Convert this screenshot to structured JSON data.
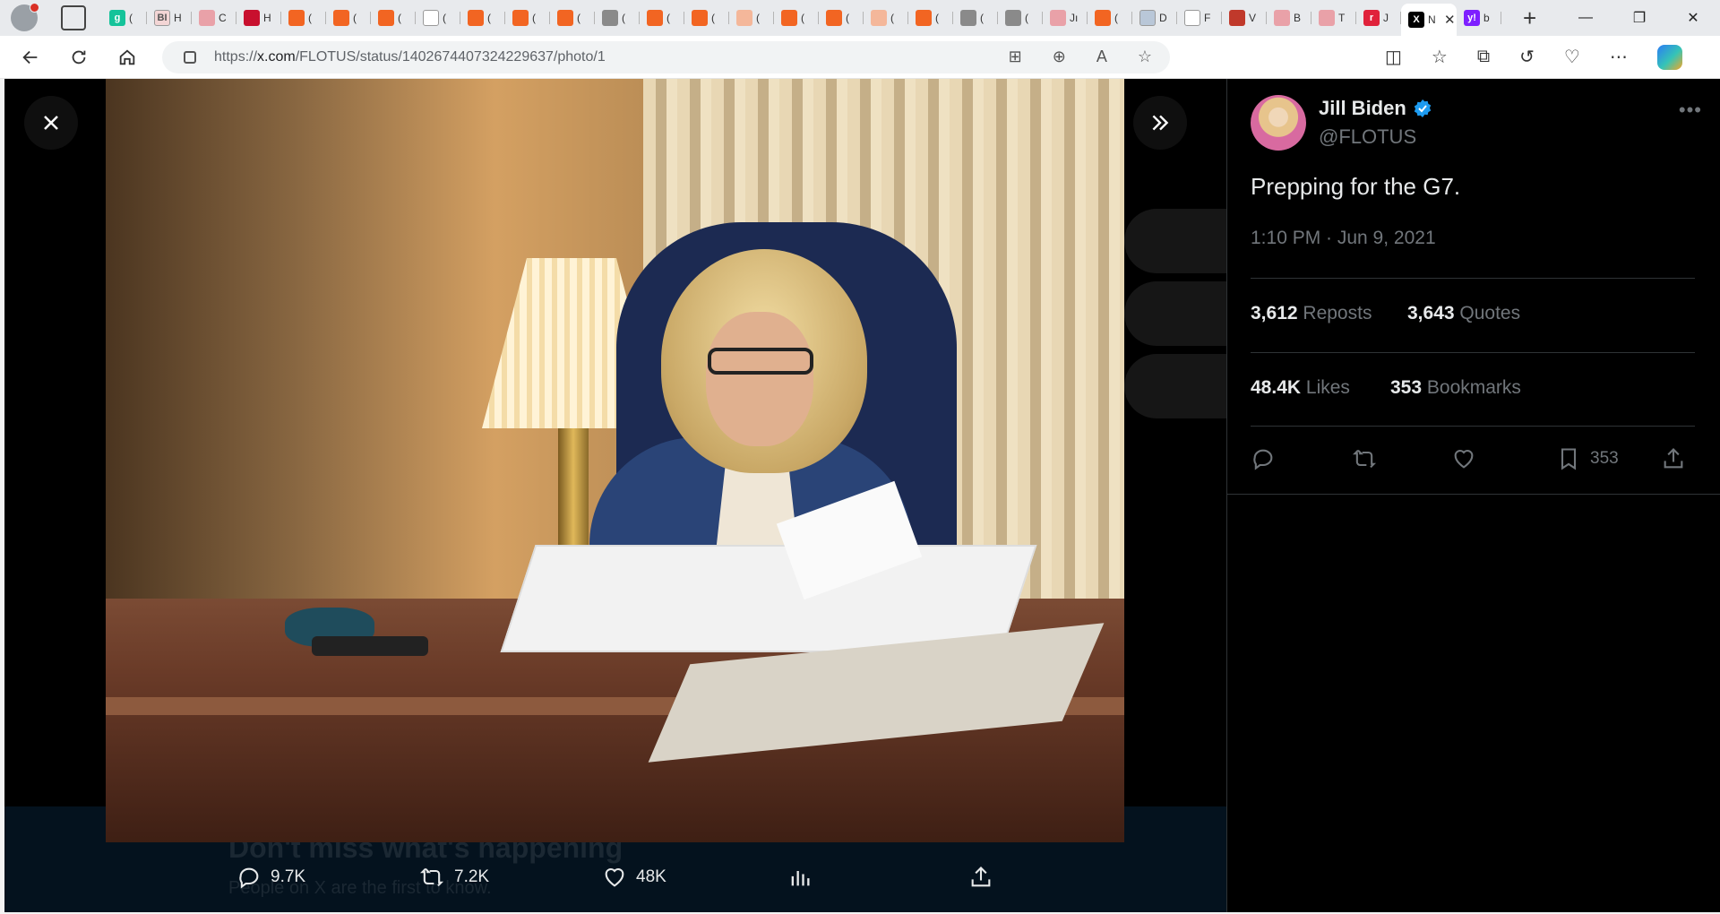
{
  "browser": {
    "tabs": [
      {
        "icon": "grammarly-icon",
        "letter": "g",
        "title": "(",
        "color": "#15c39a"
      },
      {
        "icon": "bi-icon",
        "letter": "BI",
        "title": "H",
        "color": "#f3d5d5"
      },
      {
        "icon": "youtube-icon",
        "letter": "",
        "title": "C",
        "color": "#e9a1a8"
      },
      {
        "icon": "news-icon",
        "letter": "",
        "title": "H",
        "color": "#c8102e"
      },
      {
        "icon": "bookmark-icon",
        "letter": "",
        "title": "(",
        "color": "#f26522"
      },
      {
        "icon": "bookmark-icon",
        "letter": "",
        "title": "(",
        "color": "#f26522"
      },
      {
        "icon": "bookmark-icon",
        "letter": "",
        "title": "(",
        "color": "#f26522"
      },
      {
        "icon": "document-icon",
        "letter": "",
        "title": "(",
        "color": "#ffffff"
      },
      {
        "icon": "bookmark-icon",
        "letter": "",
        "title": "(",
        "color": "#f26522"
      },
      {
        "icon": "bookmark-icon",
        "letter": "",
        "title": "(",
        "color": "#f26522"
      },
      {
        "icon": "bookmark-icon",
        "letter": "",
        "title": "(",
        "color": "#f26522"
      },
      {
        "icon": "photo-icon",
        "letter": "",
        "title": "(",
        "color": "#8a8a8a"
      },
      {
        "icon": "bookmark-icon",
        "letter": "",
        "title": "(",
        "color": "#f26522"
      },
      {
        "icon": "bookmark-icon",
        "letter": "",
        "title": "(",
        "color": "#f26522"
      },
      {
        "icon": "bookmark-icon",
        "letter": "",
        "title": "(",
        "color": "#f4b79a"
      },
      {
        "icon": "bookmark-icon",
        "letter": "",
        "title": "(",
        "color": "#f26522"
      },
      {
        "icon": "bookmark-icon",
        "letter": "",
        "title": "(",
        "color": "#f26522"
      },
      {
        "icon": "bookmark-icon",
        "letter": "",
        "title": "(",
        "color": "#f4b79a"
      },
      {
        "icon": "bookmark-icon",
        "letter": "",
        "title": "(",
        "color": "#f26522"
      },
      {
        "icon": "photo-icon",
        "letter": "",
        "title": "(",
        "color": "#8a8a8a"
      },
      {
        "icon": "photo-icon",
        "letter": "",
        "title": "(",
        "color": "#8a8a8a"
      },
      {
        "icon": "youtube-icon",
        "letter": "",
        "title": "Jı",
        "color": "#e9a1a8"
      },
      {
        "icon": "bookmark-icon",
        "letter": "",
        "title": "(",
        "color": "#f26522"
      },
      {
        "icon": "puzzle-icon",
        "letter": "",
        "title": "D",
        "color": "#b9c7d8"
      },
      {
        "icon": "document-icon",
        "letter": "",
        "title": "F",
        "color": "#ffffff"
      },
      {
        "icon": "star-icon",
        "letter": "",
        "title": "V",
        "color": "#c0392b"
      },
      {
        "icon": "youtube-icon",
        "letter": "",
        "title": "B",
        "color": "#e9a1a8"
      },
      {
        "icon": "youtube-icon",
        "letter": "",
        "title": "T",
        "color": "#e9a1a8"
      },
      {
        "icon": "r-icon",
        "letter": "r",
        "title": "J",
        "color": "#e0223b"
      }
    ],
    "active_tab": {
      "icon": "x-icon",
      "letter": "X",
      "title": "N",
      "close": "✕"
    },
    "after_tabs": [
      {
        "icon": "yahoo-icon",
        "letter": "y!",
        "title": "b",
        "color": "#7e1fff"
      }
    ],
    "new_tab": "+",
    "window_controls": {
      "minimize": "—",
      "restore": "❐",
      "close": "✕"
    },
    "url_prefix": "https://",
    "url_host": "x.com",
    "url_path": "/FLOTUS/status/1402674407324229637/photo/1"
  },
  "media": {
    "close_label": "✕",
    "expand_label": "»",
    "actions": {
      "replies": "9.7K",
      "reposts": "7.2K",
      "likes": "48K"
    }
  },
  "underlay": {
    "banner_heading": "Don't miss what's happening",
    "banner_sub": "People on X are the first to know."
  },
  "tweet": {
    "name": "Jill Biden",
    "handle": "@FLOTUS",
    "text": "Prepping for the G7.",
    "timestamp": "1:10 PM · Jun 9, 2021",
    "reposts_count": "3,612",
    "reposts_label": "Reposts",
    "quotes_count": "3,643",
    "quotes_label": "Quotes",
    "likes_count": "48.4K",
    "likes_label": "Likes",
    "bookmarks_count": "353",
    "bookmarks_label": "Bookmarks",
    "bookmark_action_count": "353"
  },
  "colors": {
    "verified": "#1d9bf0",
    "text_primary": "#e7e9ea",
    "text_secondary": "#71767b"
  }
}
